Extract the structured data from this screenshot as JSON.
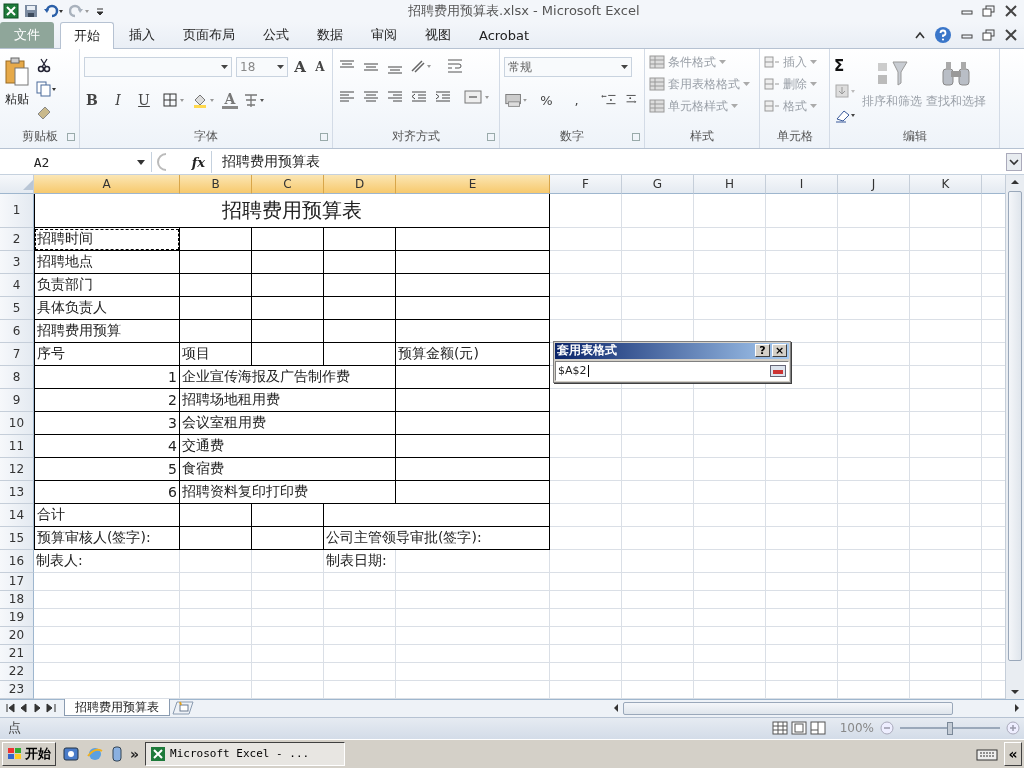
{
  "window": {
    "title": "招聘费用预算表.xlsx  -  Microsoft Excel"
  },
  "menu_tabs": [
    {
      "label": "文件",
      "kind": "file",
      "selected": false
    },
    {
      "label": "开始",
      "kind": "tab",
      "selected": true
    },
    {
      "label": "插入",
      "kind": "tab",
      "selected": false
    },
    {
      "label": "页面布局",
      "kind": "tab",
      "selected": false
    },
    {
      "label": "公式",
      "kind": "tab",
      "selected": false
    },
    {
      "label": "数据",
      "kind": "tab",
      "selected": false
    },
    {
      "label": "审阅",
      "kind": "tab",
      "selected": false
    },
    {
      "label": "视图",
      "kind": "tab",
      "selected": false
    },
    {
      "label": "Acrobat",
      "kind": "tab",
      "selected": false
    }
  ],
  "ribbon": {
    "clipboard": {
      "label": "剪贴板",
      "paste": "粘贴"
    },
    "font": {
      "label": "字体",
      "font_size": "18",
      "grow": "A",
      "shrink": "A",
      "bold": "B",
      "italic": "I",
      "underline": "U",
      "font_color": "A"
    },
    "alignment": {
      "label": "对齐方式"
    },
    "number": {
      "label": "数字",
      "format": "常规",
      "percent": "%",
      "comma": ","
    },
    "styles": {
      "label": "样式",
      "items": [
        {
          "label": "条件格式",
          "disabled": true
        },
        {
          "label": "套用表格格式",
          "disabled": true
        },
        {
          "label": "单元格样式",
          "disabled": true
        }
      ]
    },
    "cells": {
      "label": "单元格",
      "items": [
        {
          "label": "插入",
          "disabled": true
        },
        {
          "label": "删除",
          "disabled": true
        },
        {
          "label": "格式",
          "disabled": true
        }
      ]
    },
    "editing": {
      "label": "编辑",
      "sum": "Σ",
      "items": [
        {
          "label": "排序和筛选",
          "disabled": true
        },
        {
          "label": "查找和选择",
          "disabled": true
        }
      ]
    }
  },
  "formula_bar": {
    "name_box": "A2",
    "fx": "fx",
    "content": "招聘费用预算表"
  },
  "columns": [
    {
      "label": "A",
      "selected": true
    },
    {
      "label": "B",
      "selected": true
    },
    {
      "label": "C",
      "selected": true
    },
    {
      "label": "D",
      "selected": true
    },
    {
      "label": "E",
      "selected": true
    },
    {
      "label": "F",
      "selected": false
    },
    {
      "label": "G",
      "selected": false
    },
    {
      "label": "H",
      "selected": false
    },
    {
      "label": "I",
      "selected": false
    },
    {
      "label": "J",
      "selected": false
    },
    {
      "label": "K",
      "selected": false
    }
  ],
  "rows": [
    {
      "number": "1",
      "kind": "title",
      "cells": {
        "A": {
          "text": "招聘费用预算表"
        }
      }
    },
    {
      "number": "2",
      "kind": "entry",
      "cells": {
        "A": {
          "text": "招聘时间",
          "marquee": true
        }
      }
    },
    {
      "number": "3",
      "kind": "entry",
      "cells": {
        "A": {
          "text": "招聘地点"
        }
      }
    },
    {
      "number": "4",
      "kind": "entry",
      "cells": {
        "A": {
          "text": "负责部门"
        }
      }
    },
    {
      "number": "5",
      "kind": "entry",
      "cells": {
        "A": {
          "text": "具体负责人"
        }
      }
    },
    {
      "number": "6",
      "kind": "entry",
      "cells": {
        "A": {
          "text": "招聘费用预算"
        }
      }
    },
    {
      "number": "7",
      "kind": "entry",
      "cells": {
        "A": {
          "text": "序号"
        },
        "B": {
          "text": "项目"
        },
        "E": {
          "text": "预算金额(元)"
        }
      }
    },
    {
      "number": "8",
      "kind": "item",
      "cells": {
        "A": {
          "text": "1"
        },
        "B": {
          "text": "企业宣传海报及广告制作费"
        }
      }
    },
    {
      "number": "9",
      "kind": "item",
      "cells": {
        "A": {
          "text": "2"
        },
        "B": {
          "text": "招聘场地租用费"
        }
      }
    },
    {
      "number": "10",
      "kind": "item",
      "cells": {
        "A": {
          "text": "3"
        },
        "B": {
          "text": "会议室租用费"
        }
      }
    },
    {
      "number": "11",
      "kind": "item",
      "cells": {
        "A": {
          "text": "4"
        },
        "B": {
          "text": "交通费"
        }
      }
    },
    {
      "number": "12",
      "kind": "item",
      "cells": {
        "A": {
          "text": "5"
        },
        "B": {
          "text": "食宿费"
        }
      }
    },
    {
      "number": "13",
      "kind": "item",
      "cells": {
        "A": {
          "text": "6"
        },
        "B": {
          "text": "招聘资料复印打印费"
        }
      }
    },
    {
      "number": "14",
      "kind": "signature",
      "cells": {
        "A": {
          "text": "合计"
        }
      }
    },
    {
      "number": "15",
      "kind": "signature",
      "cells": {
        "A": {
          "text": "预算审核人(签字):"
        },
        "D": {
          "text": "公司主管领导审批(签字):"
        }
      }
    },
    {
      "number": "16",
      "kind": "footer",
      "cells": {
        "A": {
          "text": "制表人:"
        },
        "D": {
          "text": "制表日期:"
        }
      }
    },
    {
      "number": "17",
      "kind": "blank"
    },
    {
      "number": "18",
      "kind": "blank"
    },
    {
      "number": "19",
      "kind": "blank"
    },
    {
      "number": "20",
      "kind": "blank"
    },
    {
      "number": "21",
      "kind": "blank"
    },
    {
      "number": "22",
      "kind": "blank"
    },
    {
      "number": "23",
      "kind": "blank"
    }
  ],
  "dialog": {
    "title": "套用表格式",
    "help": "?",
    "close": "×",
    "value": "$A$2"
  },
  "sheet_tabs": [
    {
      "label": "招聘费用预算表",
      "selected": true
    }
  ],
  "status_bar": {
    "mode": "点",
    "zoom": {
      "label": "100%",
      "level": 0.5
    }
  },
  "taskbar": {
    "start": "开始",
    "more": "»",
    "task": "Microsoft Excel - ...",
    "collapse": "«"
  }
}
